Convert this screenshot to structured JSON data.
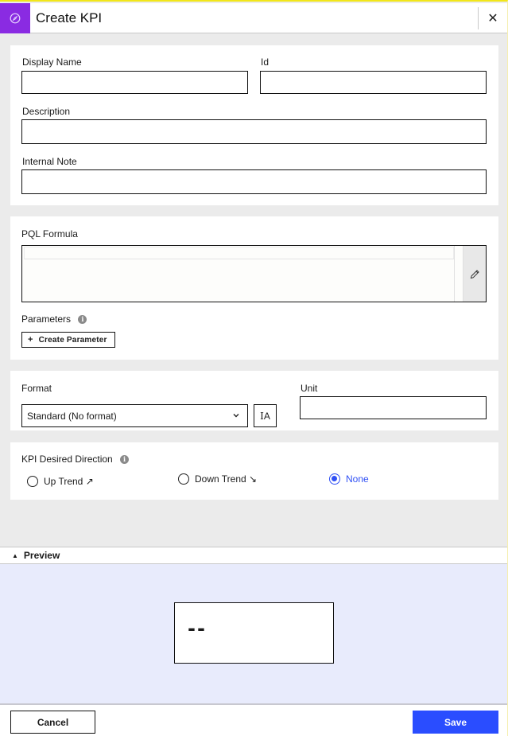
{
  "header": {
    "title": "Create KPI",
    "logo_icon": "compass-icon",
    "close_icon": "close-icon",
    "brand_color": "#8a2be2"
  },
  "basic": {
    "display_name": {
      "label": "Display Name",
      "value": ""
    },
    "id": {
      "label": "Id",
      "value": ""
    },
    "description": {
      "label": "Description",
      "value": ""
    },
    "internal_note": {
      "label": "Internal Note",
      "value": ""
    }
  },
  "formula": {
    "label": "PQL Formula",
    "value": "",
    "edit_icon": "pencil-icon",
    "parameters_label": "Parameters",
    "info_icon": "info-icon",
    "create_parameter_label": "Create Parameter",
    "create_parameter_icon": "plus-icon"
  },
  "format": {
    "label": "Format",
    "selected": "Standard (No format)",
    "format_button_icon": "text-format-icon",
    "unit_label": "Unit",
    "unit_value": ""
  },
  "direction": {
    "label": "KPI Desired Direction",
    "options": [
      {
        "label": "Up Trend ↗",
        "checked": false
      },
      {
        "label": "Down Trend ↘",
        "checked": false
      },
      {
        "label": "None",
        "checked": true
      }
    ],
    "accent_color": "#3050f5"
  },
  "preview": {
    "label": "Preview",
    "expanded": true,
    "kpi_value": "--"
  },
  "footer": {
    "cancel_label": "Cancel",
    "save_label": "Save",
    "save_color": "#2a4dff"
  }
}
